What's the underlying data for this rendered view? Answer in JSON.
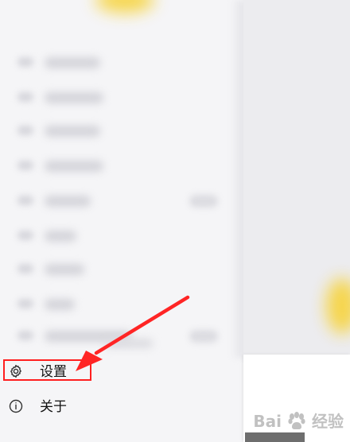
{
  "menu": {
    "settings": {
      "label": "设置",
      "icon": "gear-icon"
    },
    "about": {
      "label": "关于",
      "icon": "info-icon"
    }
  },
  "watermark": {
    "brand_latin": "Bai",
    "brand_suffix": "经验"
  },
  "colors": {
    "highlight": "#ff1f1f",
    "accent": "#f7d33a"
  }
}
